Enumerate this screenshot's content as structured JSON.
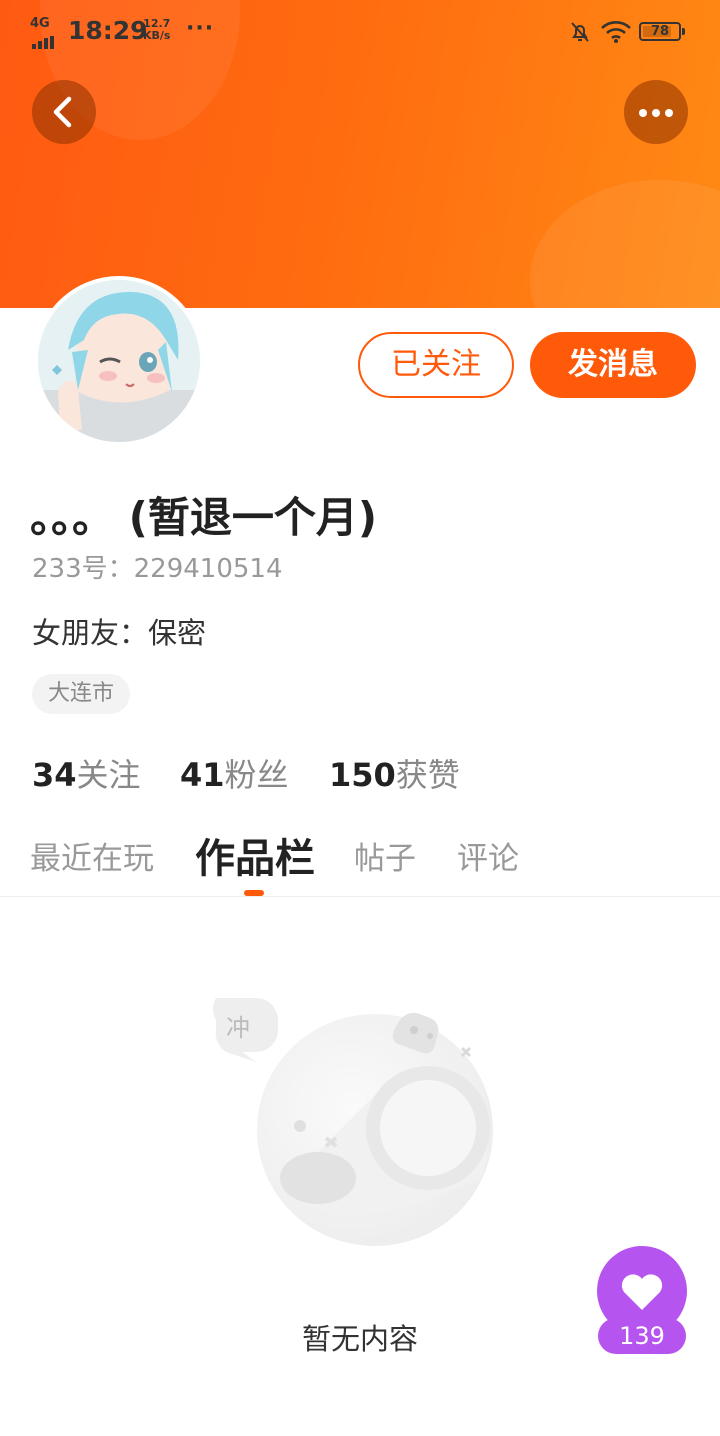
{
  "status_bar": {
    "network": "4G",
    "time": "18:29",
    "speed_value": "12.7",
    "speed_unit": "KB/s",
    "more": "···",
    "battery": "78"
  },
  "header": {
    "colors": {
      "gradient_start": "#ff5a12",
      "gradient_end": "#ff8a14"
    },
    "back_icon": "chevron-left-icon",
    "more_icon": "more-horizontal-icon"
  },
  "profile": {
    "name": "。。。  (暂退一个月)",
    "id_line": "233号：229410514",
    "girlfriend_line": "女朋友：保密",
    "location": "大连市",
    "follow_label": "已关注",
    "message_label": "发消息",
    "accent_color": "#ff5a0a"
  },
  "stats": [
    {
      "value": "34",
      "label": "关注"
    },
    {
      "value": "41",
      "label": "粉丝"
    },
    {
      "value": "150",
      "label": "获赞"
    }
  ],
  "tabs": [
    {
      "label": "最近在玩",
      "active": false
    },
    {
      "label": "作品栏",
      "active": true
    },
    {
      "label": "帖子",
      "active": false
    },
    {
      "label": "评论",
      "active": false
    }
  ],
  "empty_state": {
    "bubble_text": "冲",
    "text": "暂无内容"
  },
  "like_fab": {
    "icon": "heart-icon",
    "count": "139",
    "color": "#b654f0"
  }
}
